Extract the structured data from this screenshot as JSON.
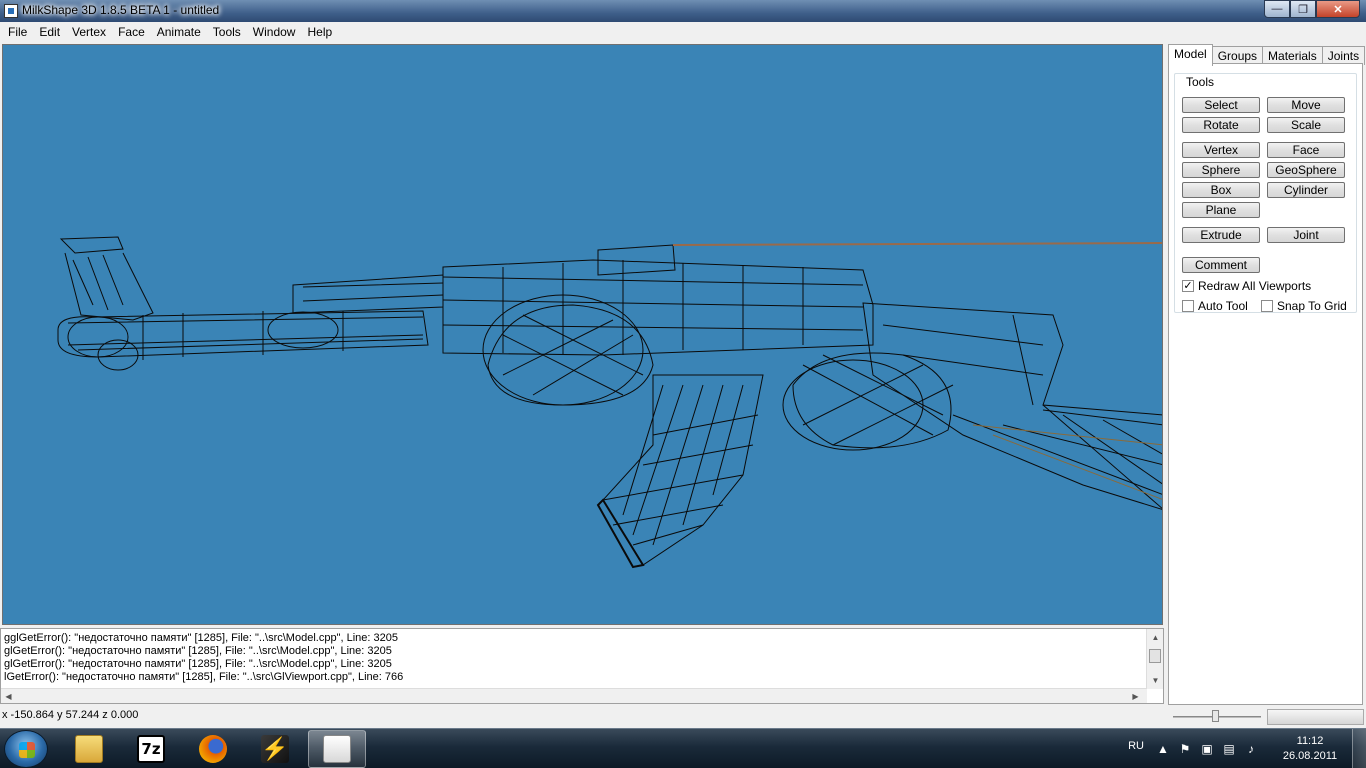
{
  "window": {
    "title": "MilkShape 3D 1.8.5 BETA 1 - untitled",
    "min_icon": "minimize-icon",
    "max_icon": "maximize-icon",
    "close_icon": "close-icon"
  },
  "menu": [
    "File",
    "Edit",
    "Vertex",
    "Face",
    "Animate",
    "Tools",
    "Window",
    "Help"
  ],
  "panel": {
    "tabs": [
      "Model",
      "Groups",
      "Materials",
      "Joints"
    ],
    "active_tab": "Model",
    "group_label": "Tools",
    "buttons": {
      "select": "Select",
      "move": "Move",
      "rotate": "Rotate",
      "scale": "Scale",
      "vertex": "Vertex",
      "face": "Face",
      "sphere": "Sphere",
      "geosphere": "GeoSphere",
      "box": "Box",
      "cylinder": "Cylinder",
      "plane": "Plane",
      "extrude": "Extrude",
      "joint": "Joint",
      "comment": "Comment"
    },
    "checks": {
      "redraw_all": {
        "label": "Redraw All Viewports",
        "checked": true
      },
      "auto_tool": {
        "label": "Auto Tool",
        "checked": false
      },
      "snap_grid": {
        "label": "Snap To Grid",
        "checked": false
      }
    }
  },
  "viewport": {
    "background": "#3a84b6",
    "wire_color": "#0a0a0a"
  },
  "log": [
    "gglGetError(): \"недостаточно памяти\" [1285], File: \"..\\src\\Model.cpp\", Line: 3205",
    "glGetError(): \"недостаточно памяти\" [1285], File: \"..\\src\\Model.cpp\", Line: 3205",
    "glGetError(): \"недостаточно памяти\" [1285], File: \"..\\src\\Model.cpp\", Line: 3205",
    "lGetError(): \"недостаточно памяти\" [1285], File: \"..\\src\\GlViewport.cpp\", Line: 766"
  ],
  "status": {
    "coords": "x -150.864 y 57.244 z 0.000"
  },
  "taskbar": {
    "items": [
      {
        "name": "explorer",
        "icon": "folder-icon",
        "color": "#e8c04a"
      },
      {
        "name": "7zip",
        "icon": "7z-icon",
        "color": "#ffffff",
        "label": "7z"
      },
      {
        "name": "firefox",
        "icon": "firefox-icon",
        "color": "#e66000"
      },
      {
        "name": "winamp",
        "icon": "winamp-icon",
        "color": "#f2c200"
      },
      {
        "name": "milkshape",
        "icon": "milkshape-icon",
        "color": "#ffffff"
      }
    ],
    "lang": "RU",
    "time": "11:12",
    "date": "26.08.2011"
  }
}
